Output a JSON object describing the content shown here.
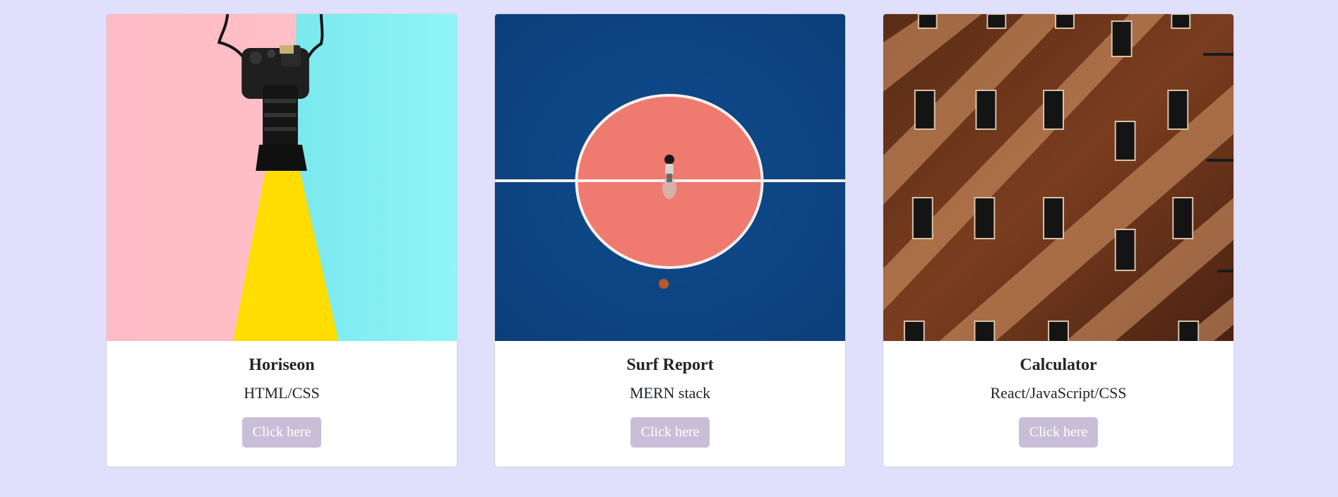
{
  "projects": [
    {
      "title": "Horiseon",
      "tech": "HTML/CSS",
      "button_label": "Click here",
      "image": "camera-on-pink-cyan-yellow-background"
    },
    {
      "title": "Surf Report",
      "tech": "MERN stack",
      "button_label": "Click here",
      "image": "aerial-basketball-court-center-circle"
    },
    {
      "title": "Calculator",
      "tech": "React/JavaScript/CSS",
      "button_label": "Click here",
      "image": "brick-building-windows-diagonal-shadows"
    }
  ],
  "colors": {
    "page_background": "#e0e0fc",
    "card_background": "#ffffff",
    "button_background": "#c9bed7",
    "button_text": "#ffffff",
    "text": "#212529"
  }
}
